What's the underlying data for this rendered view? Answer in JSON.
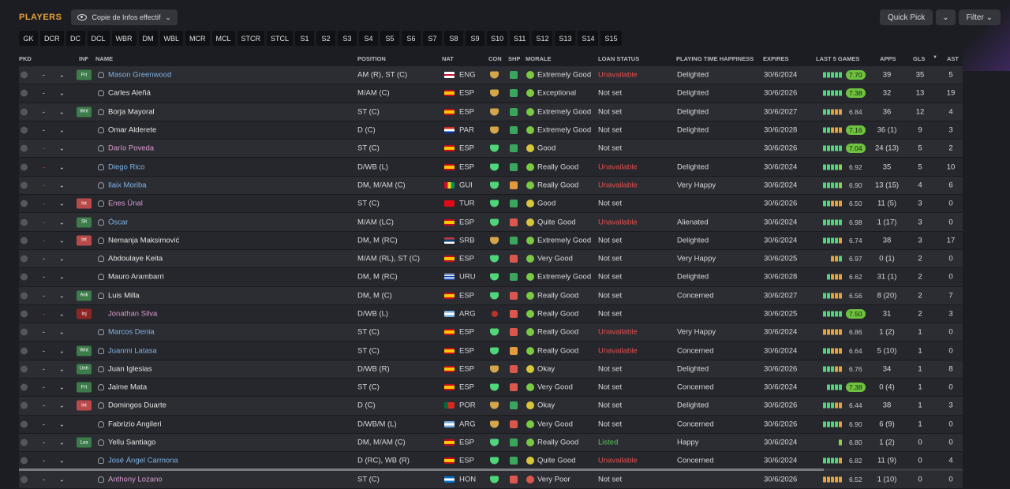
{
  "header": {
    "title": "PLAYERS",
    "view_label": "Copie de Infos effectif",
    "quick_pick": "Quick Pick",
    "filter": "Filter"
  },
  "position_filters": [
    "GK",
    "DCR",
    "DC",
    "DCL",
    "WBR",
    "DM",
    "WBL",
    "MCR",
    "MCL",
    "STCR",
    "STCL",
    "S1",
    "S2",
    "S3",
    "S4",
    "S5",
    "S6",
    "S7",
    "S8",
    "S9",
    "S10",
    "S11",
    "S12",
    "S13",
    "S14",
    "S15"
  ],
  "columns": {
    "pkd": "PKD",
    "inf": "INF",
    "name": "NAME",
    "position": "POSITION",
    "nat": "NAT",
    "con": "CON",
    "shp": "SHP",
    "morale": "MORALE",
    "loan": "LOAN STATUS",
    "pth": "PLAYING TIME HAPPINESS",
    "expires": "EXPIRES",
    "last5": "LAST 5 GAMES",
    "apps": "APPS",
    "gls": "GLS",
    "ast": "AST"
  },
  "colors": {
    "accent": "#e8a33a",
    "blue_name": "#7fb4e6",
    "pink_name": "#d79ad0",
    "unavailable": "#e05050",
    "listed": "#58c85a"
  },
  "players": [
    {
      "inf": "Frt",
      "inf_color": "green",
      "name": "Mason Greenwood",
      "name_color": "blue",
      "person": true,
      "position": "AM (R), ST (C)",
      "flag": "eng",
      "nat": "ENG",
      "con": "gold",
      "shp": "green",
      "mor": "green",
      "morale": "Extremely Good",
      "loan": "Unavailable",
      "loan_color": "red",
      "pth": "Delighted",
      "expires": "30/6/2024",
      "bars": [
        "g",
        "g",
        "g",
        "g",
        "g"
      ],
      "rating": "7.70",
      "rating_hi": true,
      "apps": "39",
      "gls": "35",
      "ast": "5",
      "dash": "-",
      "dash_red": false
    },
    {
      "inf": "",
      "name": "Carles Aleñá",
      "name_color": "white",
      "person": true,
      "position": "M/AM (C)",
      "flag": "esp",
      "nat": "ESP",
      "con": "gold",
      "shp": "green",
      "mor": "green",
      "morale": "Exceptional",
      "loan": "Not set",
      "loan_color": "",
      "pth": "Delighted",
      "expires": "30/6/2026",
      "bars": [
        "g",
        "g",
        "g",
        "g",
        "g"
      ],
      "rating": "7.38",
      "rating_hi": true,
      "apps": "32",
      "gls": "13",
      "ast": "19",
      "dash": "-",
      "dash_red": false
    },
    {
      "inf": "Wnt",
      "inf_color": "green",
      "name": "Borja Mayoral",
      "name_color": "white",
      "person": true,
      "position": "ST (C)",
      "flag": "esp",
      "nat": "ESP",
      "con": "gold",
      "shp": "green",
      "mor": "green",
      "morale": "Extremely Good",
      "loan": "Not set",
      "loan_color": "",
      "pth": "Delighted",
      "expires": "30/6/2027",
      "bars": [
        "g",
        "g",
        "o",
        "o",
        "o"
      ],
      "rating": "6.84",
      "rating_hi": false,
      "apps": "36",
      "gls": "12",
      "ast": "4",
      "dash": "-",
      "dash_red": false
    },
    {
      "inf": "",
      "name": "Omar Alderete",
      "name_color": "white",
      "person": true,
      "position": "D (C)",
      "flag": "par",
      "nat": "PAR",
      "con": "gold",
      "shp": "green",
      "mor": "green",
      "morale": "Extremely Good",
      "loan": "Not set",
      "loan_color": "",
      "pth": "Delighted",
      "expires": "30/6/2028",
      "bars": [
        "g",
        "g",
        "o",
        "o",
        "o"
      ],
      "rating": "7.16",
      "rating_hi": true,
      "apps": "36 (1)",
      "gls": "9",
      "ast": "3",
      "dash": "-",
      "dash_red": false
    },
    {
      "inf": "",
      "name": "Darío Poveda",
      "name_color": "pink",
      "person": true,
      "position": "ST (C)",
      "flag": "esp",
      "nat": "ESP",
      "con": "green",
      "shp": "green",
      "mor": "yellow",
      "morale": "Good",
      "loan": "Not set",
      "loan_color": "",
      "pth": "",
      "expires": "30/6/2026",
      "bars": [
        "g",
        "g",
        "g",
        "g",
        "g"
      ],
      "rating": "7.04",
      "rating_hi": true,
      "apps": "24 (13)",
      "gls": "5",
      "ast": "2",
      "dash": "-",
      "dash_red": true
    },
    {
      "inf": "",
      "name": "Diego Rico",
      "name_color": "blue",
      "person": true,
      "position": "D/WB (L)",
      "flag": "esp",
      "nat": "ESP",
      "con": "green",
      "shp": "green",
      "mor": "green",
      "morale": "Really Good",
      "loan": "Unavailable",
      "loan_color": "red",
      "pth": "Delighted",
      "expires": "30/6/2024",
      "bars": [
        "g",
        "g",
        "g",
        "g",
        "l"
      ],
      "rating": "6.92",
      "rating_hi": false,
      "apps": "35",
      "gls": "5",
      "ast": "10",
      "dash": "-",
      "dash_red": true
    },
    {
      "inf": "",
      "name": "Ilaix Moriba",
      "name_color": "blue",
      "person": true,
      "position": "DM, M/AM (C)",
      "flag": "gui",
      "nat": "GUI",
      "con": "green",
      "shp": "orange",
      "mor": "green",
      "morale": "Really Good",
      "loan": "Unavailable",
      "loan_color": "red",
      "pth": "Very Happy",
      "expires": "30/6/2024",
      "bars": [
        "g",
        "g",
        "g",
        "g",
        "l"
      ],
      "rating": "6.90",
      "rating_hi": false,
      "apps": "13 (15)",
      "gls": "4",
      "ast": "6",
      "dash": "-",
      "dash_red": true
    },
    {
      "inf": "Int",
      "inf_color": "red",
      "name": "Enes Ünal",
      "name_color": "pink",
      "person": true,
      "position": "ST (C)",
      "flag": "tur",
      "nat": "TUR",
      "con": "green",
      "shp": "green",
      "mor": "yellow",
      "morale": "Good",
      "loan": "Not set",
      "loan_color": "",
      "pth": "",
      "expires": "30/6/2026",
      "bars": [
        "g",
        "g",
        "o",
        "o",
        "o"
      ],
      "rating": "6.50",
      "rating_hi": false,
      "apps": "11 (5)",
      "gls": "3",
      "ast": "0",
      "dash": "-",
      "dash_red": true
    },
    {
      "inf": "Slt",
      "inf_color": "green",
      "name": "Óscar",
      "name_color": "blue",
      "person": true,
      "position": "M/AM (LC)",
      "flag": "esp",
      "nat": "ESP",
      "con": "green",
      "shp": "red",
      "mor": "yellow",
      "morale": "Quite Good",
      "loan": "Unavailable",
      "loan_color": "red",
      "pth": "Alienated",
      "expires": "30/6/2024",
      "bars": [
        "g",
        "g",
        "g",
        "g",
        "g"
      ],
      "rating": "6.98",
      "rating_hi": false,
      "apps": "1 (17)",
      "gls": "3",
      "ast": "0",
      "dash": "-",
      "dash_red": true
    },
    {
      "inf": "Int",
      "inf_color": "red",
      "name": "Nemanja Maksimović",
      "name_color": "white",
      "person": true,
      "position": "DM, M (RC)",
      "flag": "srb",
      "nat": "SRB",
      "con": "gold",
      "shp": "green",
      "mor": "green",
      "morale": "Extremely Good",
      "loan": "Not set",
      "loan_color": "",
      "pth": "Delighted",
      "expires": "30/6/2024",
      "bars": [
        "g",
        "g",
        "g",
        "g",
        "o"
      ],
      "rating": "6.74",
      "rating_hi": false,
      "apps": "38",
      "gls": "3",
      "ast": "17",
      "dash": "-",
      "dash_red": true
    },
    {
      "inf": "",
      "name": "Abdoulaye Keita",
      "name_color": "white",
      "person": true,
      "position": "M/AM (RL), ST (C)",
      "flag": "esp",
      "nat": "ESP",
      "con": "green",
      "shp": "red",
      "mor": "green",
      "morale": "Very Good",
      "loan": "Not set",
      "loan_color": "",
      "pth": "Very Happy",
      "expires": "30/6/2025",
      "bars": [
        "o",
        "o",
        "g"
      ],
      "rating": "6.97",
      "rating_hi": false,
      "apps": "0 (1)",
      "gls": "2",
      "ast": "0",
      "dash": "-",
      "dash_red": false
    },
    {
      "inf": "",
      "name": "Mauro Arambarri",
      "name_color": "white",
      "person": true,
      "position": "DM, M (RC)",
      "flag": "uru",
      "nat": "URU",
      "con": "green",
      "shp": "green",
      "mor": "green",
      "morale": "Extremely Good",
      "loan": "Not set",
      "loan_color": "",
      "pth": "Delighted",
      "expires": "30/6/2028",
      "bars": [
        "g",
        "o",
        "o",
        "o"
      ],
      "rating": "6.62",
      "rating_hi": false,
      "apps": "31 (1)",
      "gls": "2",
      "ast": "0",
      "dash": "-",
      "dash_red": false
    },
    {
      "inf": "Ank",
      "inf_color": "green",
      "name": "Luis Milla",
      "name_color": "white",
      "person": true,
      "position": "DM, M (C)",
      "flag": "esp",
      "nat": "ESP",
      "con": "green",
      "shp": "red",
      "mor": "green",
      "morale": "Really Good",
      "loan": "Not set",
      "loan_color": "",
      "pth": "Concerned",
      "expires": "30/6/2027",
      "bars": [
        "g",
        "g",
        "o",
        "o",
        "o"
      ],
      "rating": "6.56",
      "rating_hi": false,
      "apps": "8 (20)",
      "gls": "2",
      "ast": "7",
      "dash": "-",
      "dash_red": false
    },
    {
      "inf": "Inj",
      "inf_color": "darkred",
      "name": "Jonathan Silva",
      "name_color": "pink",
      "person": false,
      "position": "D/WB (L)",
      "flag": "arg",
      "nat": "ARG",
      "con": "red",
      "shp": "red",
      "mor": "green",
      "morale": "Really Good",
      "loan": "Not set",
      "loan_color": "",
      "pth": "",
      "expires": "30/6/2025",
      "bars": [
        "g",
        "g",
        "g",
        "g",
        "g"
      ],
      "rating": "7.50",
      "rating_hi": true,
      "apps": "31",
      "gls": "2",
      "ast": "3",
      "dash": "-",
      "dash_red": true
    },
    {
      "inf": "",
      "name": "Marcos Denia",
      "name_color": "blue",
      "person": true,
      "position": "ST (C)",
      "flag": "esp",
      "nat": "ESP",
      "con": "green",
      "shp": "red",
      "mor": "green",
      "morale": "Really Good",
      "loan": "Unavailable",
      "loan_color": "red",
      "pth": "Very Happy",
      "expires": "30/6/2024",
      "bars": [
        "o",
        "o",
        "o",
        "o",
        "o"
      ],
      "rating": "6.86",
      "rating_hi": false,
      "apps": "1 (2)",
      "gls": "1",
      "ast": "0",
      "dash": "-",
      "dash_red": false
    },
    {
      "inf": "Wnt",
      "inf_color": "green",
      "name": "Juanmi Latasa",
      "name_color": "blue",
      "person": true,
      "position": "ST (C)",
      "flag": "esp",
      "nat": "ESP",
      "con": "green",
      "shp": "orange",
      "mor": "green",
      "morale": "Really Good",
      "loan": "Unavailable",
      "loan_color": "red",
      "pth": "Concerned",
      "expires": "30/6/2024",
      "bars": [
        "g",
        "g",
        "o",
        "o",
        "o"
      ],
      "rating": "6.64",
      "rating_hi": false,
      "apps": "5 (10)",
      "gls": "1",
      "ast": "0",
      "dash": "-",
      "dash_red": false
    },
    {
      "inf": "Unh",
      "inf_color": "green",
      "name": "Juan Iglesias",
      "name_color": "white",
      "person": true,
      "position": "D/WB (R)",
      "flag": "esp",
      "nat": "ESP",
      "con": "gold",
      "shp": "red",
      "mor": "yellow",
      "morale": "Okay",
      "loan": "Not set",
      "loan_color": "",
      "pth": "Delighted",
      "expires": "30/6/2026",
      "bars": [
        "g",
        "g",
        "g",
        "o",
        "o"
      ],
      "rating": "6.76",
      "rating_hi": false,
      "apps": "34",
      "gls": "1",
      "ast": "8",
      "dash": "-",
      "dash_red": false
    },
    {
      "inf": "Frt",
      "inf_color": "green",
      "name": "Jaime Mata",
      "name_color": "white",
      "person": true,
      "position": "ST (C)",
      "flag": "esp",
      "nat": "ESP",
      "con": "green",
      "shp": "red",
      "mor": "green",
      "morale": "Very Good",
      "loan": "Not set",
      "loan_color": "",
      "pth": "Concerned",
      "expires": "30/6/2024",
      "bars": [
        "g",
        "g",
        "g",
        "g"
      ],
      "rating": "7.38",
      "rating_hi": true,
      "apps": "0 (4)",
      "gls": "1",
      "ast": "0",
      "dash": "-",
      "dash_red": false
    },
    {
      "inf": "Int",
      "inf_color": "red",
      "name": "Domingos Duarte",
      "name_color": "white",
      "person": true,
      "position": "D (C)",
      "flag": "por",
      "nat": "POR",
      "con": "gold",
      "shp": "green",
      "mor": "yellow",
      "morale": "Okay",
      "loan": "Not set",
      "loan_color": "",
      "pth": "Delighted",
      "expires": "30/6/2026",
      "bars": [
        "g",
        "g",
        "g",
        "o",
        "o"
      ],
      "rating": "6.44",
      "rating_hi": false,
      "apps": "38",
      "gls": "1",
      "ast": "3",
      "dash": "-",
      "dash_red": false
    },
    {
      "inf": "",
      "name": "Fabrizio Angileri",
      "name_color": "white",
      "person": true,
      "position": "D/WB/M (L)",
      "flag": "arg",
      "nat": "ARG",
      "con": "gold",
      "shp": "red",
      "mor": "green",
      "morale": "Very Good",
      "loan": "Not set",
      "loan_color": "",
      "pth": "Concerned",
      "expires": "30/6/2026",
      "bars": [
        "g",
        "g",
        "g",
        "g",
        "o"
      ],
      "rating": "6.90",
      "rating_hi": false,
      "apps": "6 (9)",
      "gls": "1",
      "ast": "0",
      "dash": "-",
      "dash_red": false
    },
    {
      "inf": "Loa",
      "inf_color": "green",
      "name": "Yellu Santiago",
      "name_color": "white",
      "person": true,
      "position": "DM, M/AM (C)",
      "flag": "esp",
      "nat": "ESP",
      "con": "green",
      "shp": "green",
      "mor": "green",
      "morale": "Really Good",
      "loan": "Listed",
      "loan_color": "green",
      "pth": "Happy",
      "expires": "30/6/2024",
      "bars": [
        "l"
      ],
      "rating": "6.80",
      "rating_hi": false,
      "apps": "1 (2)",
      "gls": "0",
      "ast": "0",
      "dash": "-",
      "dash_red": false
    },
    {
      "inf": "",
      "name": "José Ángel Carmona",
      "name_color": "blue",
      "person": true,
      "position": "D (RC), WB (R)",
      "flag": "esp",
      "nat": "ESP",
      "con": "green",
      "shp": "green",
      "mor": "yellow",
      "morale": "Quite Good",
      "loan": "Unavailable",
      "loan_color": "red",
      "pth": "Concerned",
      "expires": "30/6/2024",
      "bars": [
        "g",
        "g",
        "g",
        "g",
        "o"
      ],
      "rating": "6.82",
      "rating_hi": false,
      "apps": "11 (9)",
      "gls": "0",
      "ast": "4",
      "dash": "-",
      "dash_red": false
    },
    {
      "inf": "",
      "name": "Anthony Lozano",
      "name_color": "pink",
      "person": true,
      "position": "ST (C)",
      "flag": "hon",
      "nat": "HON",
      "con": "green",
      "shp": "red",
      "mor": "red",
      "morale": "Very Poor",
      "loan": "Not set",
      "loan_color": "",
      "pth": "",
      "expires": "30/6/2026",
      "bars": [
        "o",
        "o",
        "o",
        "o",
        "o"
      ],
      "rating": "6.52",
      "rating_hi": false,
      "apps": "1 (10)",
      "gls": "0",
      "ast": "0",
      "dash": "-",
      "dash_red": false
    }
  ]
}
